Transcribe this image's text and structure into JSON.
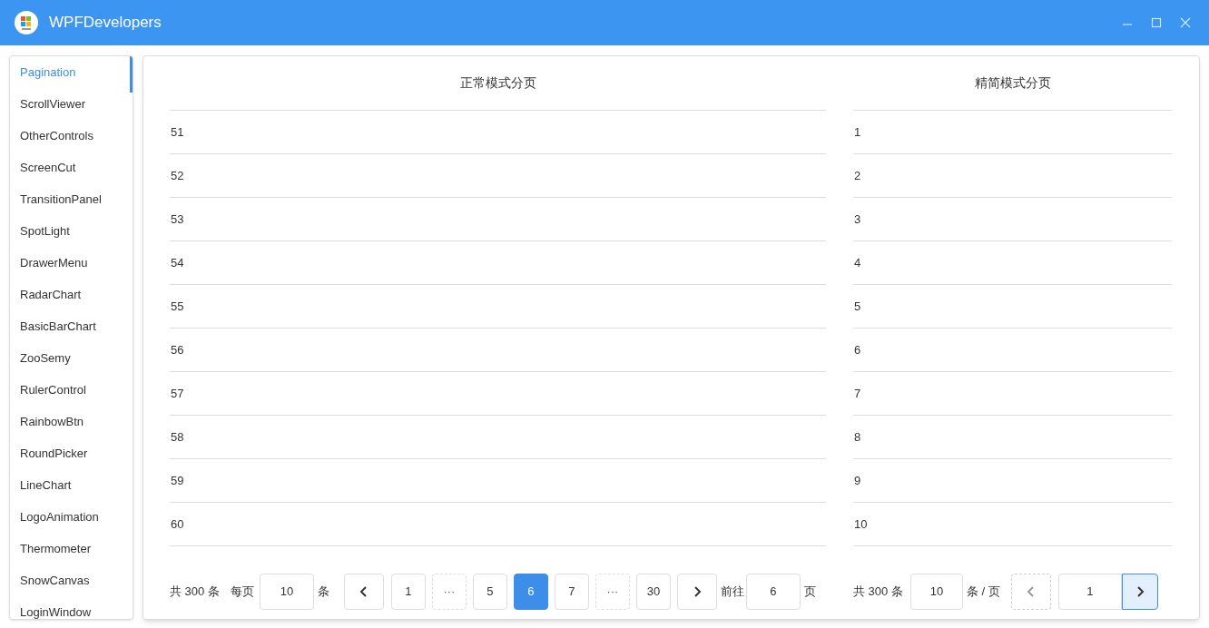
{
  "window": {
    "title": "WPFDevelopers"
  },
  "sidebar": {
    "items": [
      {
        "label": "Pagination",
        "selected": true
      },
      {
        "label": "ScrollViewer",
        "selected": false
      },
      {
        "label": "OtherControls",
        "selected": false
      },
      {
        "label": "ScreenCut",
        "selected": false
      },
      {
        "label": "TransitionPanel",
        "selected": false
      },
      {
        "label": "SpotLight",
        "selected": false
      },
      {
        "label": "DrawerMenu",
        "selected": false
      },
      {
        "label": "RadarChart",
        "selected": false
      },
      {
        "label": "BasicBarChart",
        "selected": false
      },
      {
        "label": "ZooSemy",
        "selected": false
      },
      {
        "label": "RulerControl",
        "selected": false
      },
      {
        "label": "RainbowBtn",
        "selected": false
      },
      {
        "label": "RoundPicker",
        "selected": false
      },
      {
        "label": "LineChart",
        "selected": false
      },
      {
        "label": "LogoAnimation",
        "selected": false
      },
      {
        "label": "Thermometer",
        "selected": false
      },
      {
        "label": "SnowCanvas",
        "selected": false
      },
      {
        "label": "LoginWindow",
        "selected": false
      }
    ]
  },
  "normal": {
    "title": "正常模式分页",
    "rows": [
      "51",
      "52",
      "53",
      "54",
      "55",
      "56",
      "57",
      "58",
      "59",
      "60"
    ],
    "pagination": {
      "total": "共 300 条",
      "per_page_label": "每页",
      "per_page": "10",
      "per_page_unit": "条",
      "pages": [
        {
          "kind": "page",
          "label": "1",
          "selected": false
        },
        {
          "kind": "ellipsis",
          "label": "···"
        },
        {
          "kind": "page",
          "label": "5",
          "selected": false
        },
        {
          "kind": "page",
          "label": "6",
          "selected": true
        },
        {
          "kind": "page",
          "label": "7",
          "selected": false
        },
        {
          "kind": "ellipsis",
          "label": "···"
        },
        {
          "kind": "page",
          "label": "30",
          "selected": false
        }
      ],
      "goto_label": "前往",
      "goto": "6",
      "goto_unit": "页"
    }
  },
  "simple": {
    "title": "精简模式分页",
    "rows": [
      "1",
      "2",
      "3",
      "4",
      "5",
      "6",
      "7",
      "8",
      "9",
      "10"
    ],
    "pagination": {
      "total": "共 300 条",
      "per_page": "10",
      "per_page_unit": "条 / 页",
      "current": "1",
      "prev_disabled": true,
      "next_hovered": true
    }
  }
}
